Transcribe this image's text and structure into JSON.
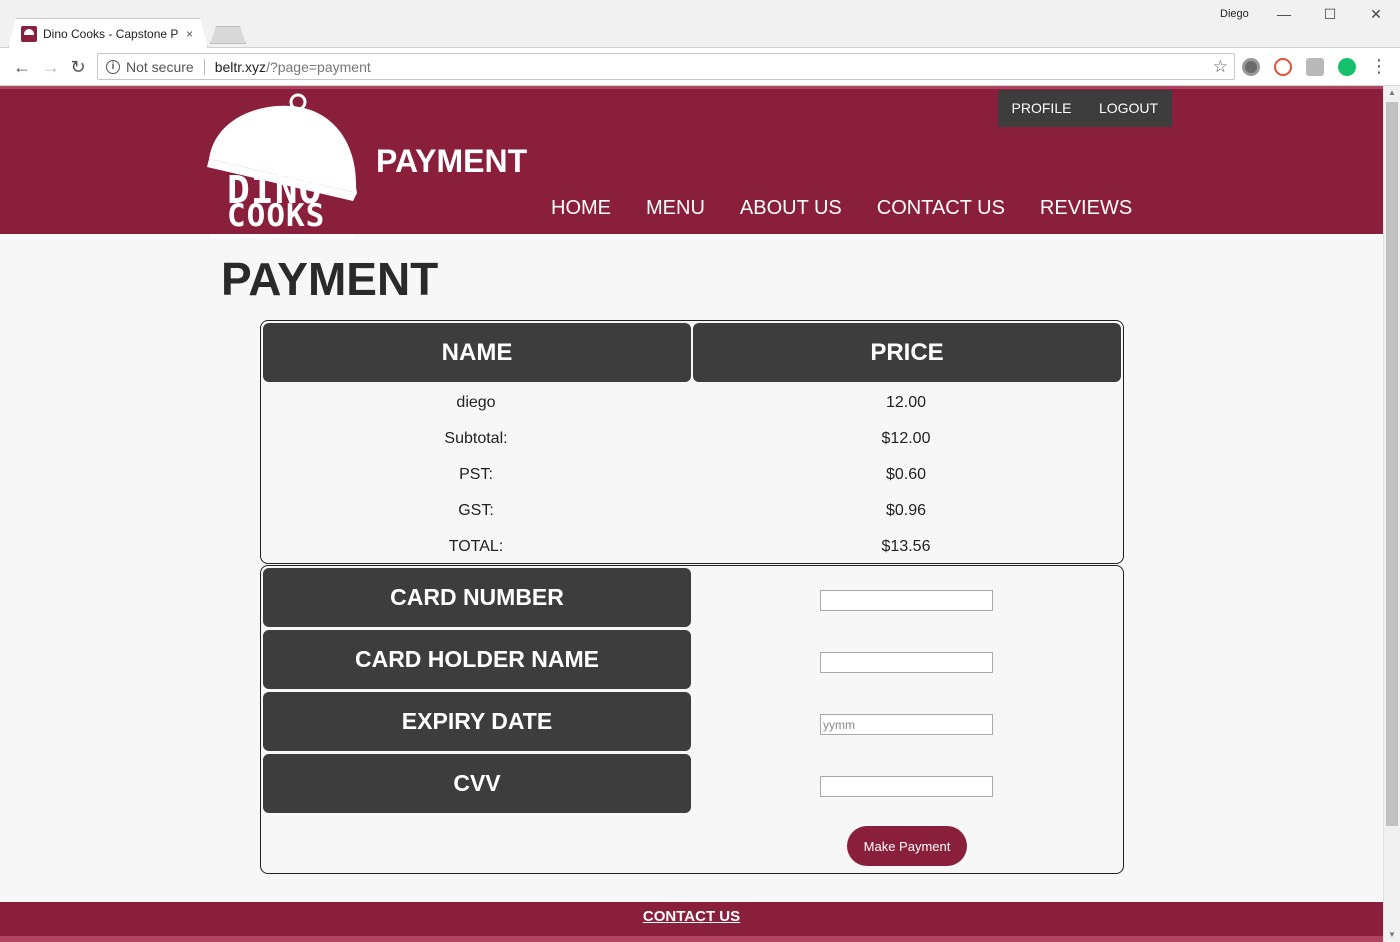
{
  "browser": {
    "tab_title": "Dino Cooks - Capstone P",
    "tab_close": "×",
    "profile_name": "Diego",
    "window_controls": {
      "minimize": "—",
      "maximize": "☐",
      "close": "✕"
    },
    "nav": {
      "back": "←",
      "forward": "→",
      "reload": "↻"
    },
    "security_label": "Not secure",
    "url_host": "beltr.xyz",
    "url_path": "/?page=payment",
    "bookmark_icon": "☆",
    "menu_icon": "⋮"
  },
  "header": {
    "logo_line1": "DINO",
    "logo_line2": "COOKS",
    "title": "PAYMENT",
    "user_menu": {
      "profile": "PROFILE",
      "logout": "LOGOUT"
    },
    "nav_items": [
      "HOME",
      "MENU",
      "ABOUT US",
      "CONTACT US",
      "REVIEWS"
    ],
    "brand_color": "#8a1f3c"
  },
  "main": {
    "heading": "PAYMENT",
    "order_table": {
      "columns": [
        "NAME",
        "PRICE"
      ],
      "rows": [
        [
          "diego",
          "12.00"
        ],
        [
          "Subtotal:",
          "$12.00"
        ],
        [
          "PST:",
          "$0.60"
        ],
        [
          "GST:",
          "$0.96"
        ],
        [
          "TOTAL:",
          "$13.56"
        ]
      ]
    },
    "card_form": {
      "card_number_label": "CARD NUMBER",
      "card_number_value": "",
      "holder_label": "CARD HOLDER NAME",
      "holder_value": "",
      "expiry_label": "EXPIRY DATE",
      "expiry_placeholder": "yymm",
      "cvv_label": "CVV",
      "cvv_value": "",
      "submit_label": "Make Payment"
    }
  },
  "footer": {
    "contact_link": "CONTACT US"
  }
}
